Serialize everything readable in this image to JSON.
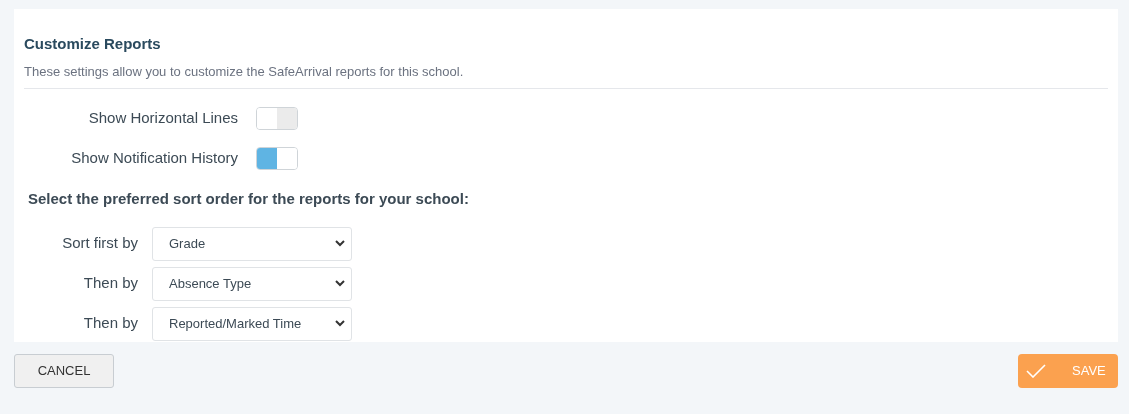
{
  "section": {
    "title": "Customize Reports",
    "description": "These settings allow you to customize the SafeArrival reports for this school."
  },
  "toggles": [
    {
      "label": "Show Horizontal Lines",
      "on": false
    },
    {
      "label": "Show Notification History",
      "on": true
    }
  ],
  "sort": {
    "heading": "Select the preferred sort order for the reports for your school:",
    "rows": [
      {
        "label": "Sort first by",
        "value": "Grade"
      },
      {
        "label": "Then by",
        "value": "Absence Type"
      },
      {
        "label": "Then by",
        "value": "Reported/Marked Time"
      }
    ]
  },
  "buttons": {
    "cancel": "CANCEL",
    "save": "SAVE"
  }
}
